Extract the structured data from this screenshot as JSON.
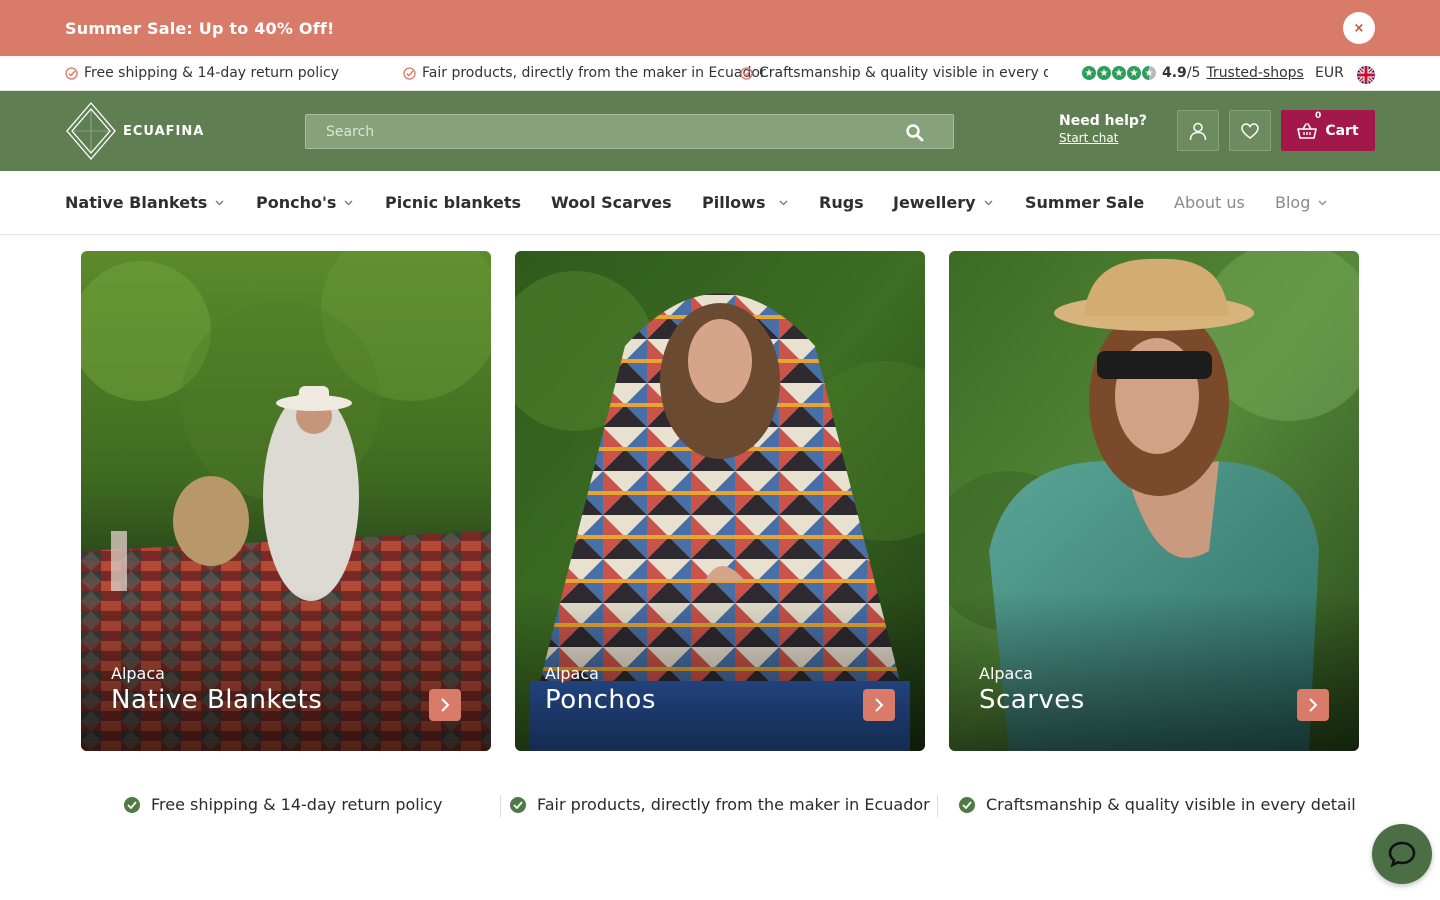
{
  "promo": {
    "text": "Summer Sale: Up to 40% Off!",
    "close_label": "×"
  },
  "usp_strip": {
    "items": [
      "Free shipping & 14-day return policy",
      "Fair products, directly from the maker in Ecuador",
      "Craftsmanship & quality visible in every detail"
    ],
    "rating_score": "4.9",
    "rating_scale": "/5",
    "rating_source": "Trusted-shops",
    "currency": "EUR"
  },
  "header": {
    "logo_text": "ECUAFINA",
    "search_placeholder": "Search",
    "help_title": "Need help?",
    "help_link": "Start chat",
    "cart_label": "Cart",
    "cart_count": "0"
  },
  "nav": {
    "items": [
      {
        "label": "Native Blankets",
        "dropdown": true
      },
      {
        "label": "Poncho's",
        "dropdown": true
      },
      {
        "label": "Picnic blankets",
        "dropdown": false
      },
      {
        "label": "Wool Scarves",
        "dropdown": false
      },
      {
        "label": "Pillows",
        "dropdown": true
      },
      {
        "label": "Rugs",
        "dropdown": false
      },
      {
        "label": "Jewellery",
        "dropdown": true
      },
      {
        "label": "Summer Sale",
        "dropdown": false
      },
      {
        "label": "About us",
        "dropdown": false
      },
      {
        "label": "Blog",
        "dropdown": true
      }
    ]
  },
  "cards": [
    {
      "subtitle": "Alpaca",
      "title": "Native Blankets"
    },
    {
      "subtitle": "Alpaca",
      "title": "Ponchos"
    },
    {
      "subtitle": "Alpaca",
      "title": "Scarves"
    }
  ],
  "usp_row": {
    "items": [
      "Free shipping & 14-day return policy",
      "Fair products, directly from the maker in Ecuador",
      "Craftsmanship & quality visible in every detail"
    ]
  },
  "colors": {
    "promo": "#d97b69",
    "header": "#5f7f52",
    "cart": "#a3184a",
    "accent": "#d97b69",
    "check": "#4e7a45"
  }
}
